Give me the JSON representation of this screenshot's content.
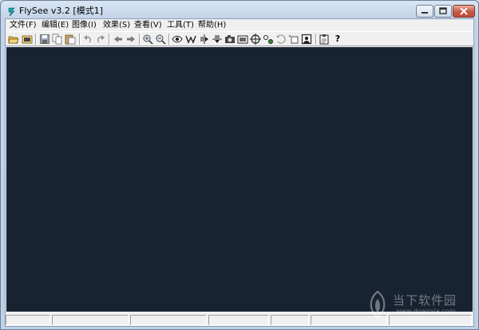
{
  "window": {
    "title": "FlySee v3.2 [模式1]"
  },
  "menubar": {
    "items": [
      {
        "label": "文件(F)"
      },
      {
        "label": "编辑(E)"
      },
      {
        "label": "图像(I)"
      },
      {
        "label": "效果(S)"
      },
      {
        "label": "查看(V)"
      },
      {
        "label": "工具(T)"
      },
      {
        "label": "帮助(H)"
      }
    ]
  },
  "toolbar": {
    "icons": [
      "open-folder-icon",
      "open-image-icon",
      "save-icon",
      "copy-icon",
      "paste-icon",
      "undo-icon",
      "redo-icon",
      "back-arrow-icon",
      "forward-arrow-icon",
      "zoom-in-icon",
      "zoom-out-icon",
      "eye-icon",
      "wave-icon",
      "flip-horizontal-icon",
      "flip-vertical-icon",
      "camera-icon",
      "screen-capture-icon",
      "crosshair-icon",
      "adjust-icon",
      "rotate-icon",
      "crop-icon",
      "portrait-icon",
      "clipboard-icon",
      "help-icon"
    ],
    "help_label": "?"
  },
  "canvas": {
    "background": "#182332"
  },
  "statusbar": {
    "panes": [
      "",
      "",
      "",
      "",
      "",
      "",
      ""
    ]
  },
  "watermark": {
    "name": "当下软件园",
    "url": "www.downxia.com"
  }
}
